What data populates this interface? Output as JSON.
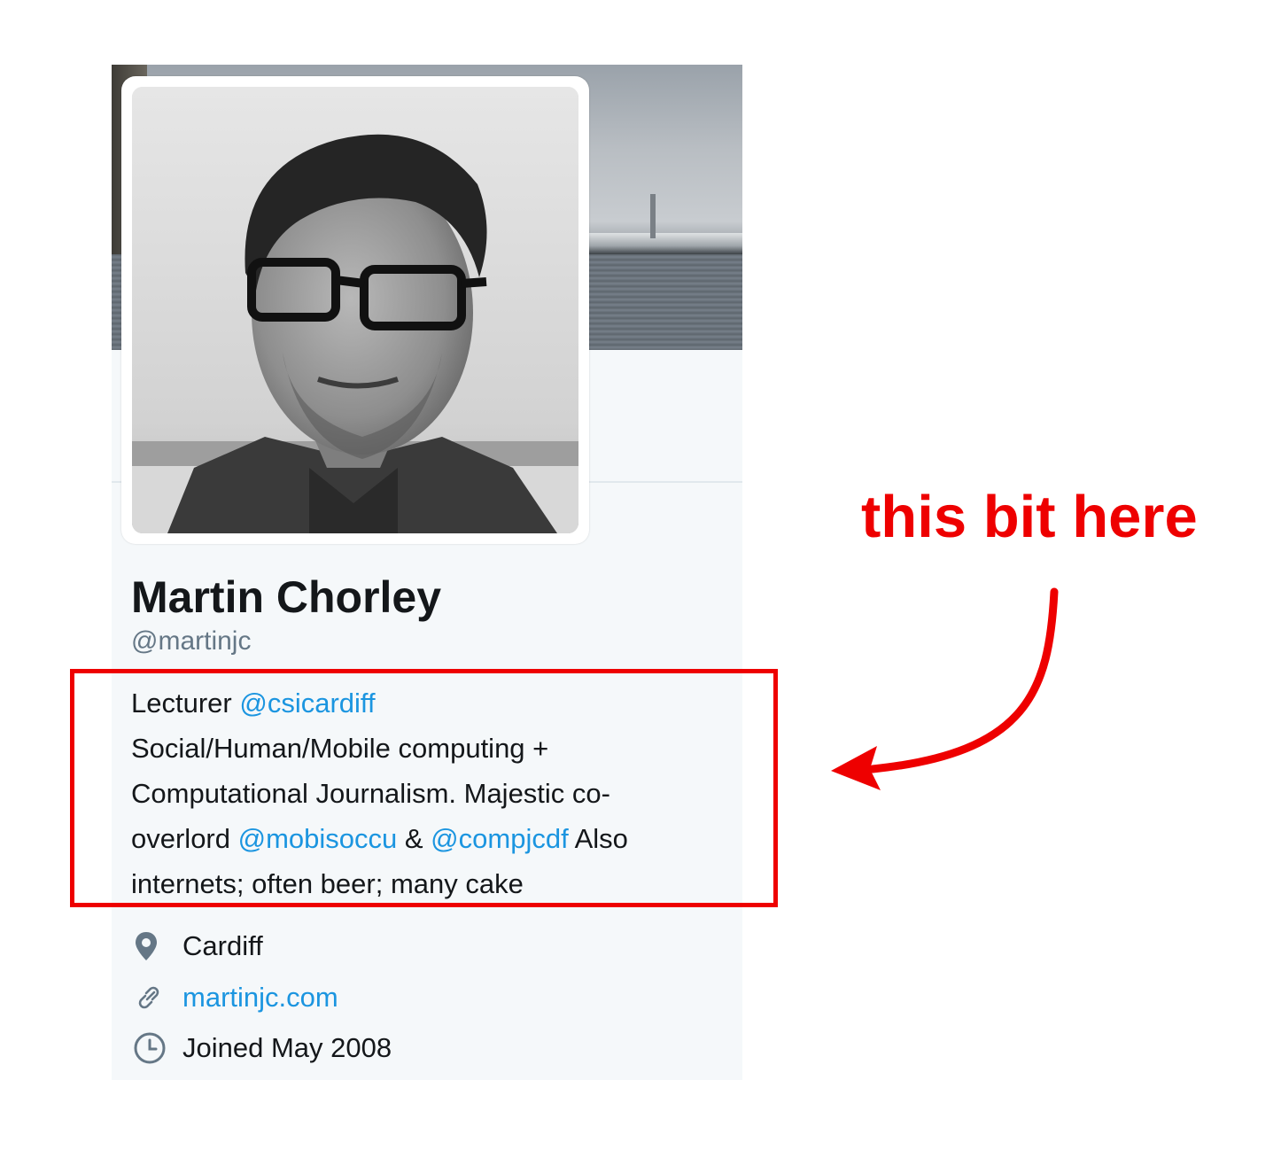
{
  "profile": {
    "name": "Martin Chorley",
    "handle": "@martinjc",
    "bio": {
      "line1_text": "Lecturer ",
      "line1_mention": "@csicardiff",
      "line2": "Social/Human/Mobile computing +",
      "line3": "Computational Journalism. Majestic co-",
      "line4_text1": "overlord ",
      "line4_mention1": "@mobisoccu",
      "line4_text2": " & ",
      "line4_mention2": "@compjcdf",
      "line4_text3": " Also",
      "line5": "internets; often beer; many cake"
    },
    "location": "Cardiff",
    "website": "martinjc.com",
    "joined": "Joined May 2008"
  },
  "annotation": {
    "text": "this bit here",
    "color": "#ee0000"
  },
  "colors": {
    "link": "#1b95e0",
    "card_background": "#f5f8fa",
    "handle": "#657786"
  },
  "icons": [
    "location-pin-icon",
    "link-icon",
    "clock-icon"
  ]
}
